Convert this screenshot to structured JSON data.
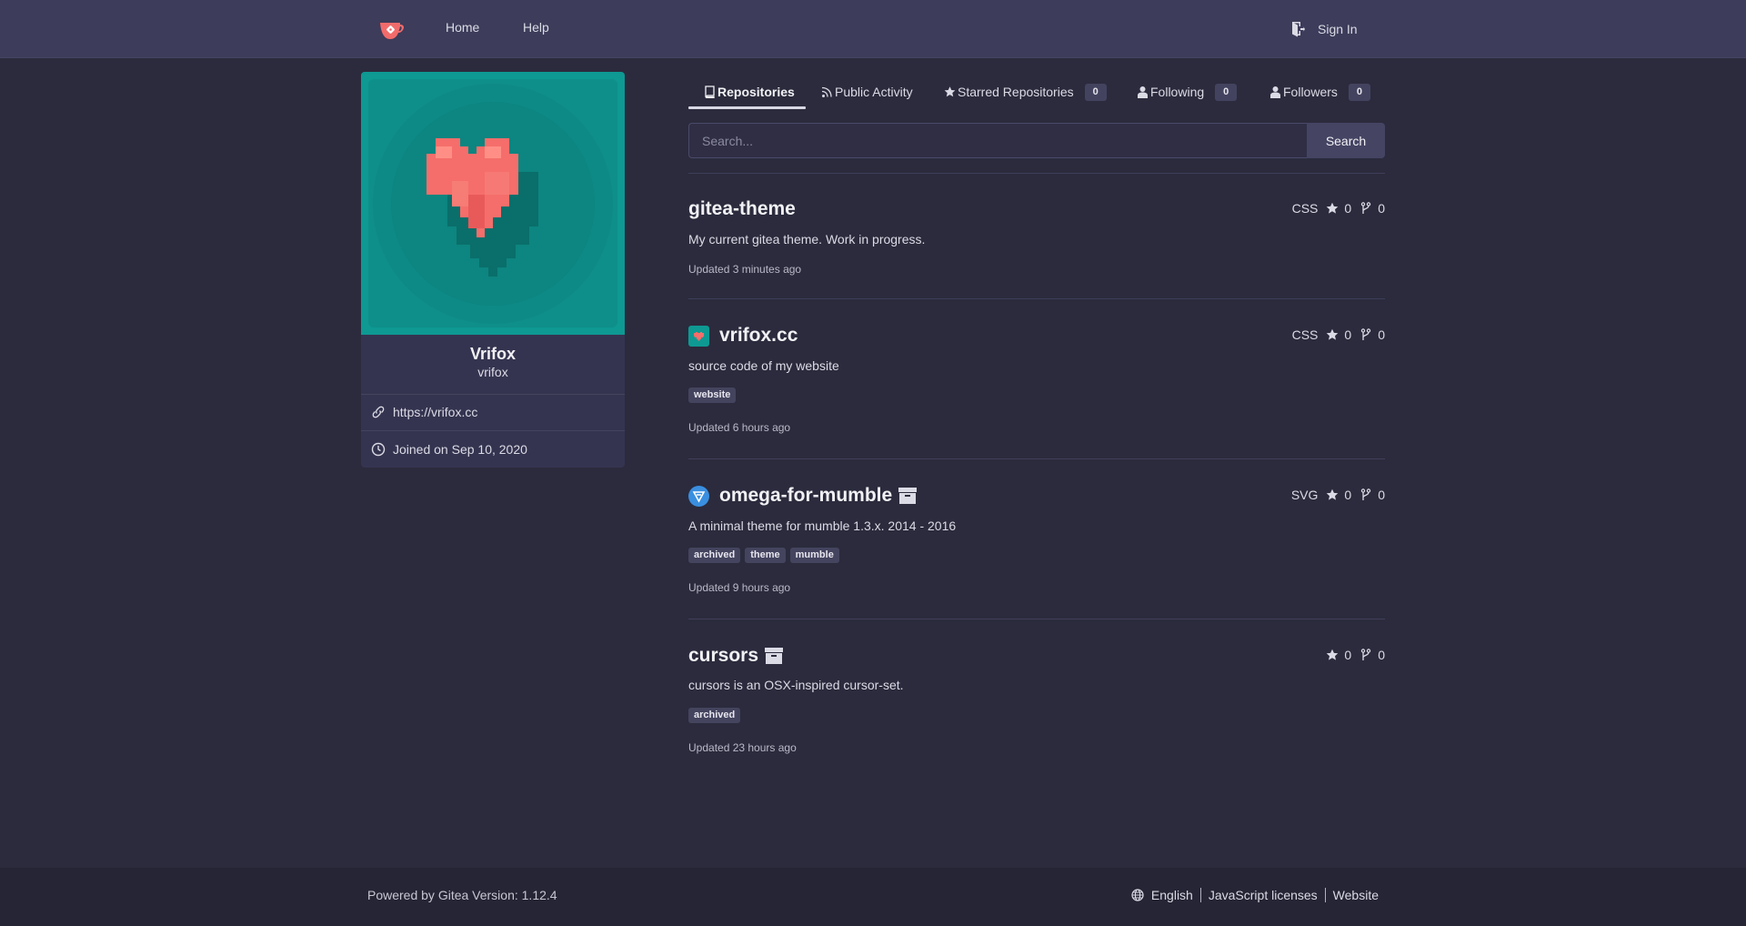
{
  "nav": {
    "home_label": "Home",
    "help_label": "Help",
    "sign_in_label": "Sign In",
    "logo_icon": "gitea-teacup-logo"
  },
  "profile": {
    "full_name": "Vrifox",
    "username": "vrifox",
    "website": "https://vrifox.cc",
    "joined": "Joined on Sep 10, 2020",
    "avatar_icon": "pixel-heart-avatar"
  },
  "tabs": [
    {
      "label": "Repositories",
      "icon": "repo-icon",
      "active": true
    },
    {
      "label": "Public Activity",
      "icon": "rss-icon"
    },
    {
      "label": "Starred Repositories",
      "icon": "star-icon",
      "count": "0"
    },
    {
      "label": "Following",
      "icon": "person-icon",
      "count": "0"
    },
    {
      "label": "Followers",
      "icon": "person-icon",
      "count": "0"
    }
  ],
  "search": {
    "placeholder": "Search...",
    "button_label": "Search"
  },
  "repos": [
    {
      "name": "gitea-theme",
      "language": "CSS",
      "stars": "0",
      "forks": "0",
      "description": "My current gitea theme. Work in progress.",
      "topics": [],
      "updated": "Updated 3 minutes ago",
      "archived": false
    },
    {
      "name": "vrifox.cc",
      "language": "CSS",
      "stars": "0",
      "forks": "0",
      "description": "source code of my website",
      "topics": [
        "website"
      ],
      "updated": "Updated 6 hours ago",
      "archived": false,
      "avatar": "heart-repo-avatar"
    },
    {
      "name": "omega-for-mumble",
      "language": "SVG",
      "stars": "0",
      "forks": "0",
      "description": "A minimal theme for mumble 1.3.x. 2014 - 2016",
      "topics": [
        "archived",
        "theme",
        "mumble"
      ],
      "updated": "Updated 9 hours ago",
      "archived": true,
      "avatar": "mumble-repo-avatar"
    },
    {
      "name": "cursors",
      "language": "",
      "stars": "0",
      "forks": "0",
      "description": "cursors is an OSX-inspired cursor-set.",
      "topics": [
        "archived"
      ],
      "updated": "Updated 23 hours ago",
      "archived": true
    }
  ],
  "footer": {
    "powered_by": "Powered by Gitea Version: 1.12.4",
    "language": "English",
    "js_licenses": "JavaScript licenses",
    "website": "Website"
  },
  "colors": {
    "navbar": "#3d3c5a",
    "background": "#2b2b3d",
    "footer": "#252535",
    "avatar_teal": "#0e8b87",
    "heart": "#f26b6b"
  }
}
